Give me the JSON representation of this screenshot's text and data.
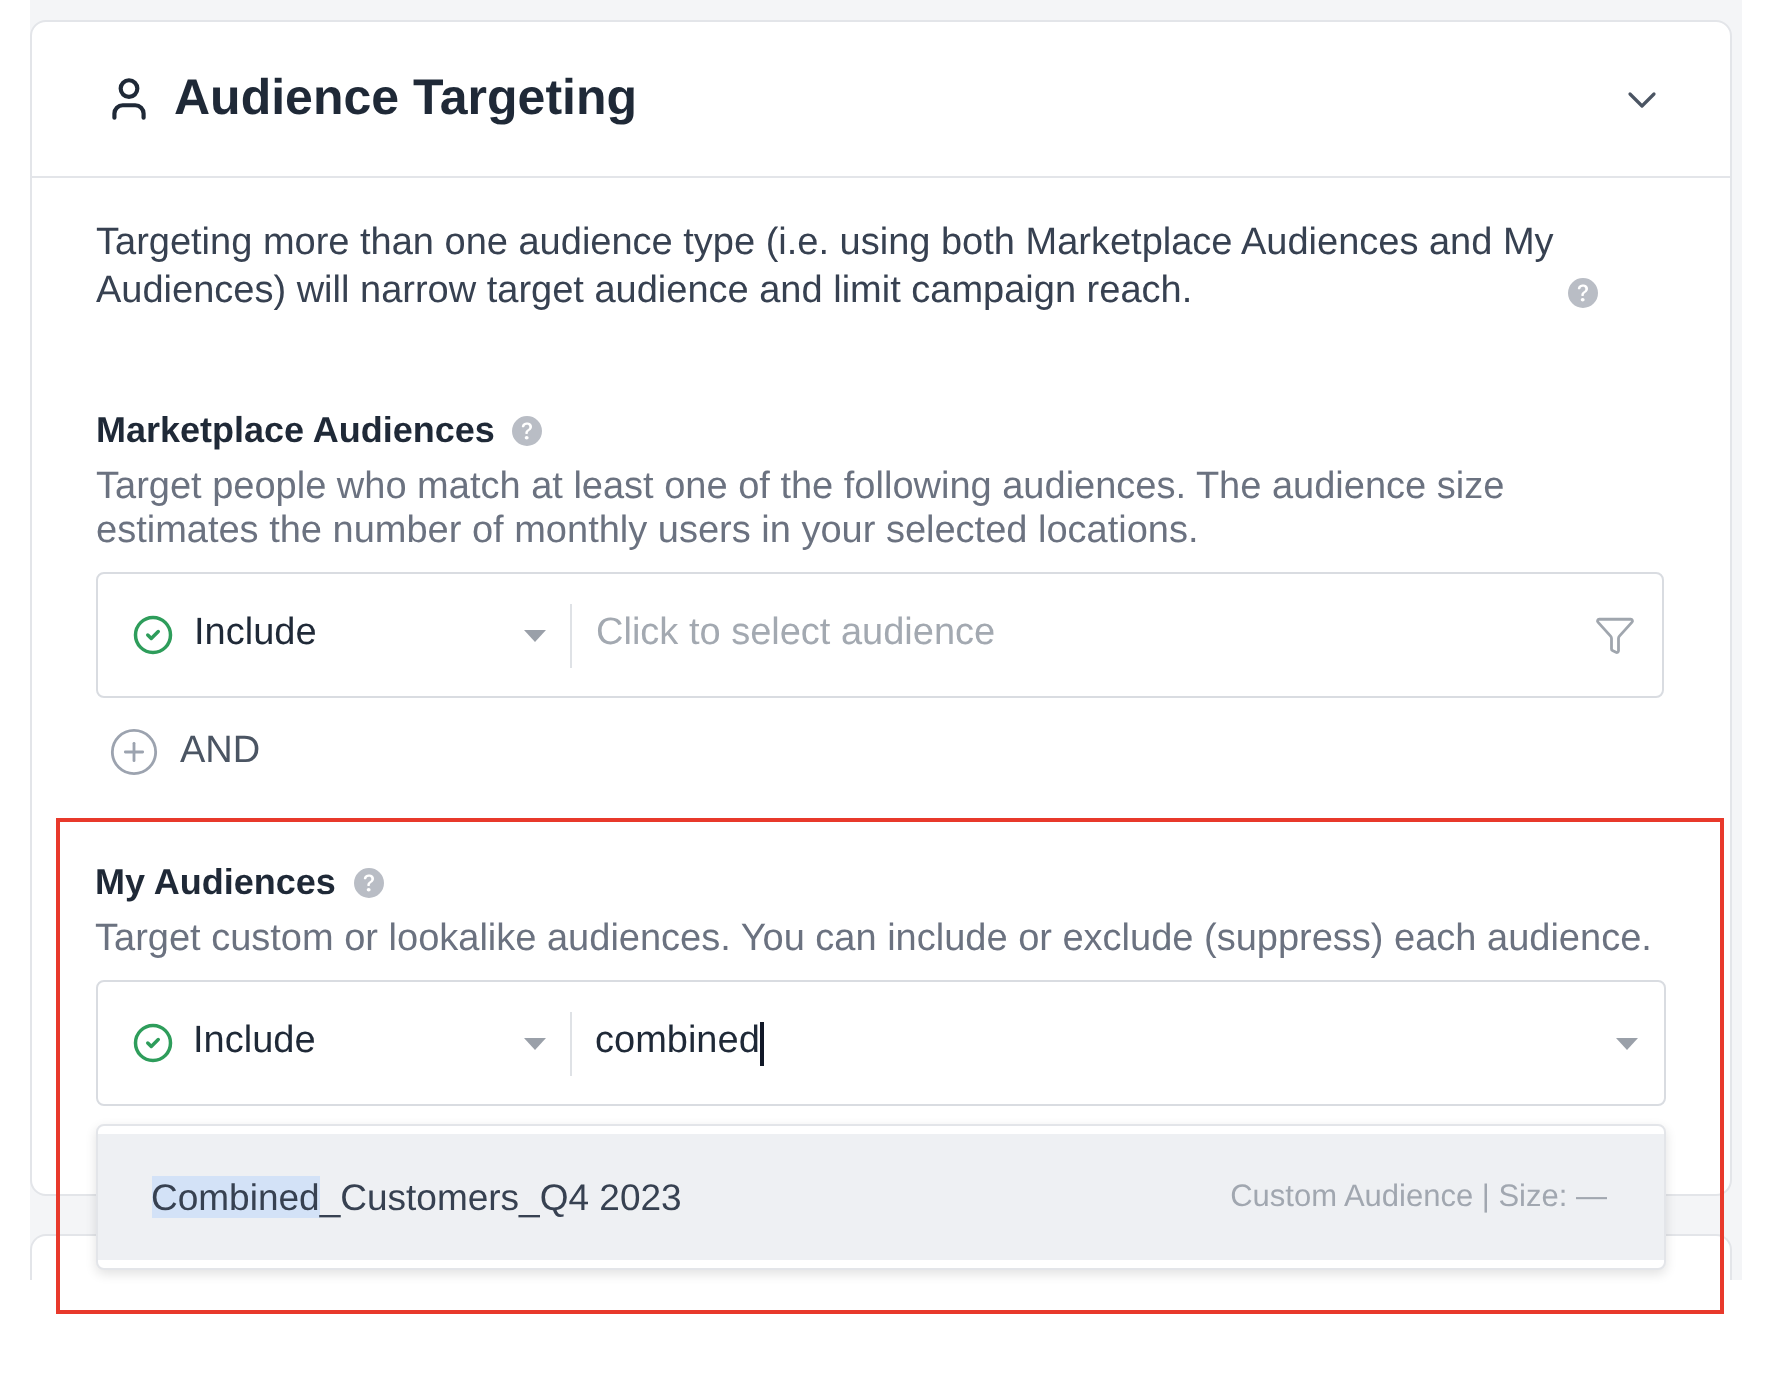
{
  "section": {
    "title": "Audience Targeting",
    "intro": "Targeting more than one audience type (i.e. using both Marketplace Audiences and My Audiences) will narrow target audience and limit campaign reach."
  },
  "groups": [
    {
      "title": "Marketplace Audiences",
      "description": "Target people who match at least one of the following audiences. The audience size estimates the number of monthly users in your selected locations.",
      "highlighted": false,
      "rule": {
        "kind": "filter",
        "mode": "Include",
        "placeholder": "Click to select audience"
      },
      "and_label": "AND"
    },
    {
      "title": "My Audiences",
      "description": "Target custom or lookalike audiences. You can include or exclude (suppress) each audience.",
      "highlighted": true,
      "rule": {
        "kind": "dropdown",
        "mode": "Include",
        "query": "combined"
      },
      "suggestions": [
        {
          "label_parts": [
            {
              "text": "Combined",
              "match": true
            },
            {
              "text": "_Customers_Q4 2023",
              "match": false
            }
          ],
          "meta": "Custom Audience | Size: —",
          "selected": true
        }
      ]
    }
  ]
}
